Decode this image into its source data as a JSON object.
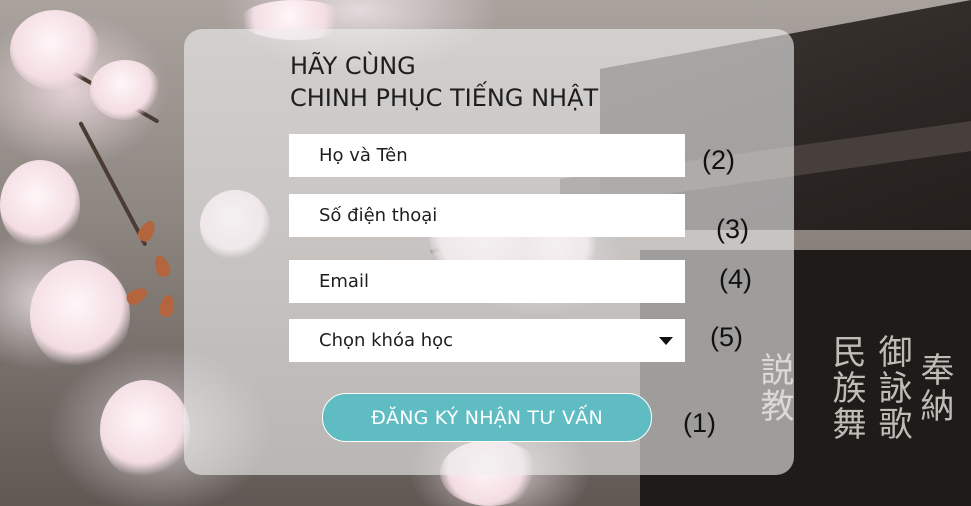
{
  "form": {
    "headline_line1": "HÃY CÙNG",
    "headline_line2": "CHINH PHỤC TIẾNG NHẬT",
    "fullname_placeholder": "Họ và Tên",
    "phone_placeholder": "Số điện thoại",
    "email_placeholder": "Email",
    "course_select_label": "Chọn khóa học",
    "submit_label": "ĐĂNG KÝ NHẬN TƯ VẤN"
  },
  "annotations": {
    "submit": "(1)",
    "fullname": "(2)",
    "phone": "(3)",
    "email": "(4)",
    "course": "(5)"
  },
  "colors": {
    "button": "#5fbcc3",
    "card": "#eeeeee"
  },
  "icons": {
    "dropdown": "caret-down-icon"
  }
}
